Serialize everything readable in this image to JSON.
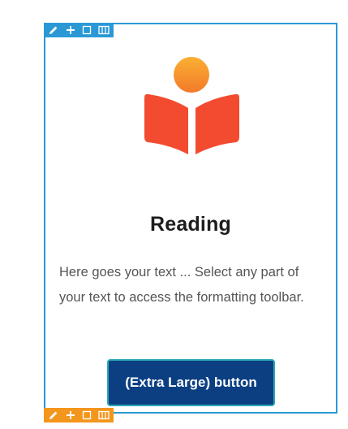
{
  "section": {
    "heading": "Reading",
    "body": "Here goes your text ... Select any part of your text to access the formatting toolbar.",
    "button_label": "(Extra Large) button"
  },
  "toolbars": {
    "top_color": "#2b98d6",
    "bottom_color": "#f3961d",
    "icons": [
      "pencil-icon",
      "plus-icon",
      "square-icon",
      "columns-icon"
    ]
  },
  "colors": {
    "frame": "#2b98d6",
    "icon_head": "#f8a02a",
    "icon_book": "#f34b2f",
    "button_bg": "#0b3f82",
    "button_border": "#2ba8b4"
  }
}
